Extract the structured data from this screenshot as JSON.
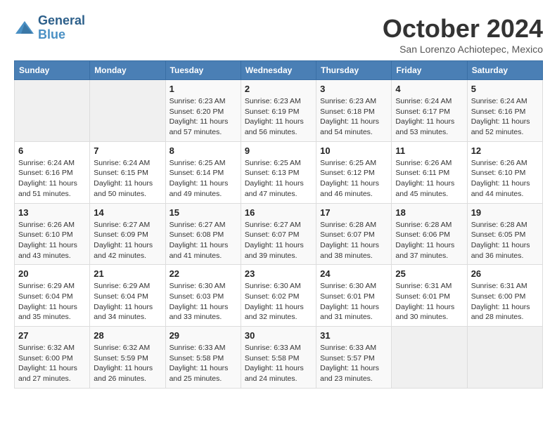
{
  "header": {
    "logo_line1": "General",
    "logo_line2": "Blue",
    "month": "October 2024",
    "location": "San Lorenzo Achiotepec, Mexico"
  },
  "days_of_week": [
    "Sunday",
    "Monday",
    "Tuesday",
    "Wednesday",
    "Thursday",
    "Friday",
    "Saturday"
  ],
  "weeks": [
    [
      {
        "day": "",
        "info": ""
      },
      {
        "day": "",
        "info": ""
      },
      {
        "day": "1",
        "info": "Sunrise: 6:23 AM\nSunset: 6:20 PM\nDaylight: 11 hours and 57 minutes."
      },
      {
        "day": "2",
        "info": "Sunrise: 6:23 AM\nSunset: 6:19 PM\nDaylight: 11 hours and 56 minutes."
      },
      {
        "day": "3",
        "info": "Sunrise: 6:23 AM\nSunset: 6:18 PM\nDaylight: 11 hours and 54 minutes."
      },
      {
        "day": "4",
        "info": "Sunrise: 6:24 AM\nSunset: 6:17 PM\nDaylight: 11 hours and 53 minutes."
      },
      {
        "day": "5",
        "info": "Sunrise: 6:24 AM\nSunset: 6:16 PM\nDaylight: 11 hours and 52 minutes."
      }
    ],
    [
      {
        "day": "6",
        "info": "Sunrise: 6:24 AM\nSunset: 6:16 PM\nDaylight: 11 hours and 51 minutes."
      },
      {
        "day": "7",
        "info": "Sunrise: 6:24 AM\nSunset: 6:15 PM\nDaylight: 11 hours and 50 minutes."
      },
      {
        "day": "8",
        "info": "Sunrise: 6:25 AM\nSunset: 6:14 PM\nDaylight: 11 hours and 49 minutes."
      },
      {
        "day": "9",
        "info": "Sunrise: 6:25 AM\nSunset: 6:13 PM\nDaylight: 11 hours and 47 minutes."
      },
      {
        "day": "10",
        "info": "Sunrise: 6:25 AM\nSunset: 6:12 PM\nDaylight: 11 hours and 46 minutes."
      },
      {
        "day": "11",
        "info": "Sunrise: 6:26 AM\nSunset: 6:11 PM\nDaylight: 11 hours and 45 minutes."
      },
      {
        "day": "12",
        "info": "Sunrise: 6:26 AM\nSunset: 6:10 PM\nDaylight: 11 hours and 44 minutes."
      }
    ],
    [
      {
        "day": "13",
        "info": "Sunrise: 6:26 AM\nSunset: 6:10 PM\nDaylight: 11 hours and 43 minutes."
      },
      {
        "day": "14",
        "info": "Sunrise: 6:27 AM\nSunset: 6:09 PM\nDaylight: 11 hours and 42 minutes."
      },
      {
        "day": "15",
        "info": "Sunrise: 6:27 AM\nSunset: 6:08 PM\nDaylight: 11 hours and 41 minutes."
      },
      {
        "day": "16",
        "info": "Sunrise: 6:27 AM\nSunset: 6:07 PM\nDaylight: 11 hours and 39 minutes."
      },
      {
        "day": "17",
        "info": "Sunrise: 6:28 AM\nSunset: 6:07 PM\nDaylight: 11 hours and 38 minutes."
      },
      {
        "day": "18",
        "info": "Sunrise: 6:28 AM\nSunset: 6:06 PM\nDaylight: 11 hours and 37 minutes."
      },
      {
        "day": "19",
        "info": "Sunrise: 6:28 AM\nSunset: 6:05 PM\nDaylight: 11 hours and 36 minutes."
      }
    ],
    [
      {
        "day": "20",
        "info": "Sunrise: 6:29 AM\nSunset: 6:04 PM\nDaylight: 11 hours and 35 minutes."
      },
      {
        "day": "21",
        "info": "Sunrise: 6:29 AM\nSunset: 6:04 PM\nDaylight: 11 hours and 34 minutes."
      },
      {
        "day": "22",
        "info": "Sunrise: 6:30 AM\nSunset: 6:03 PM\nDaylight: 11 hours and 33 minutes."
      },
      {
        "day": "23",
        "info": "Sunrise: 6:30 AM\nSunset: 6:02 PM\nDaylight: 11 hours and 32 minutes."
      },
      {
        "day": "24",
        "info": "Sunrise: 6:30 AM\nSunset: 6:01 PM\nDaylight: 11 hours and 31 minutes."
      },
      {
        "day": "25",
        "info": "Sunrise: 6:31 AM\nSunset: 6:01 PM\nDaylight: 11 hours and 30 minutes."
      },
      {
        "day": "26",
        "info": "Sunrise: 6:31 AM\nSunset: 6:00 PM\nDaylight: 11 hours and 28 minutes."
      }
    ],
    [
      {
        "day": "27",
        "info": "Sunrise: 6:32 AM\nSunset: 6:00 PM\nDaylight: 11 hours and 27 minutes."
      },
      {
        "day": "28",
        "info": "Sunrise: 6:32 AM\nSunset: 5:59 PM\nDaylight: 11 hours and 26 minutes."
      },
      {
        "day": "29",
        "info": "Sunrise: 6:33 AM\nSunset: 5:58 PM\nDaylight: 11 hours and 25 minutes."
      },
      {
        "day": "30",
        "info": "Sunrise: 6:33 AM\nSunset: 5:58 PM\nDaylight: 11 hours and 24 minutes."
      },
      {
        "day": "31",
        "info": "Sunrise: 6:33 AM\nSunset: 5:57 PM\nDaylight: 11 hours and 23 minutes."
      },
      {
        "day": "",
        "info": ""
      },
      {
        "day": "",
        "info": ""
      }
    ]
  ]
}
